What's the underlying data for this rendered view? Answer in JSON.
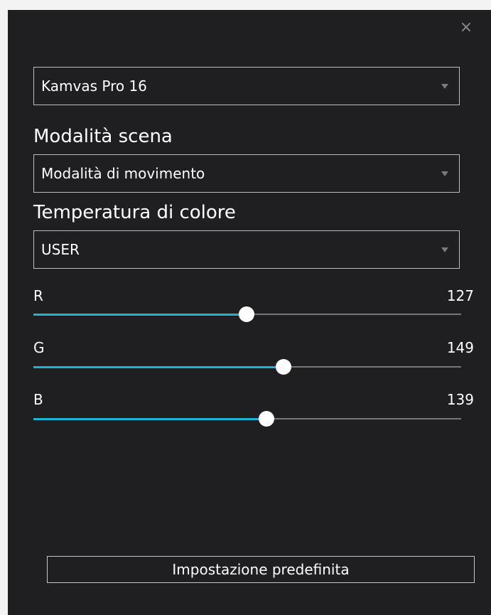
{
  "window": {
    "close_glyph": "×"
  },
  "device_select": {
    "value": "Kamvas Pro 16"
  },
  "scene_mode": {
    "label": "Modalità scena",
    "value": "Modalità di movimento"
  },
  "color_temperature": {
    "label": "Temperatura di colore",
    "value": "USER"
  },
  "sliders": {
    "max": 255,
    "r": {
      "label": "R",
      "value": 127
    },
    "g": {
      "label": "G",
      "value": 149
    },
    "b": {
      "label": "B",
      "value": 139
    }
  },
  "reset_button": {
    "label": "Impostazione predefinita"
  },
  "colors": {
    "panel_bg": "#1f1f21",
    "accent": "#1db3d3",
    "track": "#777777",
    "border": "#bcbcbc"
  }
}
